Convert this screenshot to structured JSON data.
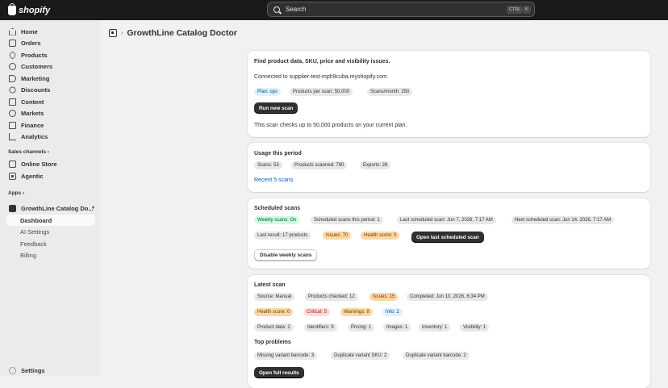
{
  "topbar": {
    "brand": "shopify",
    "search_placeholder": "Search",
    "kbd_ctrl": "CTRL",
    "kbd_k": "K"
  },
  "sidebar": {
    "items": [
      "Home",
      "Orders",
      "Products",
      "Customers",
      "Marketing",
      "Discounts",
      "Content",
      "Markets",
      "Finance",
      "Analytics"
    ],
    "sales_channels_label": "Sales channels",
    "channels": [
      "Online Store",
      "Agentic"
    ],
    "apps_label": "Apps",
    "app_name": "GrowthLine Catalog Do...",
    "app_sub": [
      "Dashboard",
      "AI Settings",
      "Feedback",
      "Billing"
    ],
    "settings": "Settings"
  },
  "header": {
    "separator": "›",
    "title": "GrowthLine Catalog Doctor"
  },
  "card1": {
    "title": "Find product data, SKU, price and visibility issues.",
    "connected": "Connected to supplier-test-mph9cuba.myshopify.com",
    "badges": [
      "Plan: ops",
      "Products per scan: 50,000",
      "Scans/month: 250"
    ],
    "run_button": "Run new scan",
    "note": "This scan checks up to 50,000 products on your current plan."
  },
  "card2": {
    "title": "Usage this period",
    "badges": [
      "Scans: 53",
      "Products scanned: 780",
      "Exports: 28"
    ],
    "link": "Recent 5 scans"
  },
  "card3": {
    "title": "Scheduled scans",
    "row1": [
      "Weekly scans: On",
      "Scheduled scans this period: 1",
      "Last scheduled scan: Jun 7, 2026, 7:17 AM",
      "Next scheduled scan: Jun 14, 2026, 7:17 AM"
    ],
    "row2": [
      "Last result: 17 products",
      "Issues: 70",
      "Health score: 0"
    ],
    "open_button": "Open last scheduled scan",
    "disable_button": "Disable weekly scans"
  },
  "card4": {
    "title": "Latest scan",
    "row1": [
      "Source: Manual",
      "Products checked: 12",
      "Issues: 15",
      "Completed: Jun 10, 2026, 6:34 PM"
    ],
    "row2": [
      "Health score: 0",
      "Critical: 5",
      "Warnings: 8",
      "Info: 2"
    ],
    "row3": [
      "Product data: 2",
      "Identifiers: 9",
      "Pricing: 1",
      "Images: 1",
      "Inventory: 1",
      "Visibility: 1"
    ],
    "top_problems_title": "Top problems",
    "problems": [
      "Missing variant barcode: 3",
      "Duplicate variant SKU: 2",
      "Duplicate variant barcode: 2"
    ],
    "open_full": "Open full results"
  }
}
